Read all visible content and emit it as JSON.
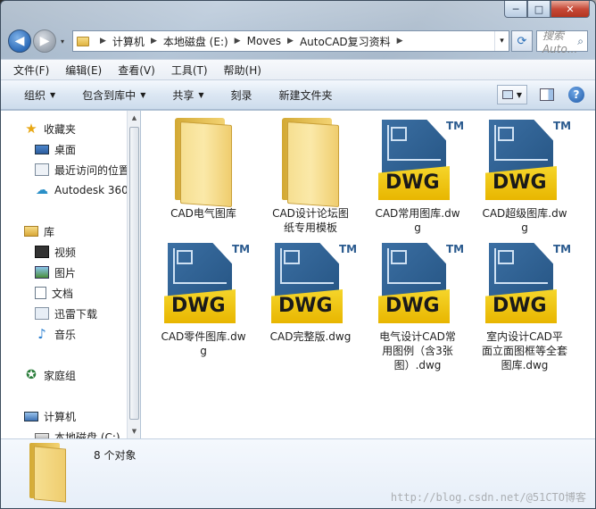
{
  "window": {
    "caption": {
      "minimize": "─",
      "maximize": "□",
      "close": "✕"
    }
  },
  "nav": {
    "back_icon": "◀",
    "forward_icon": "▶",
    "history_icon": "▾",
    "breadcrumb": [
      "计算机",
      "本地磁盘 (E:)",
      "Moves",
      "AutoCAD复习资料"
    ],
    "address_dropdown_icon": "▾",
    "refresh_icon": "⟳",
    "search_placeholder": "搜索 Auto...",
    "search_icon": "⌕"
  },
  "menu": [
    "文件(F)",
    "编辑(E)",
    "查看(V)",
    "工具(T)",
    "帮助(H)"
  ],
  "toolbar": {
    "organize": "组织",
    "include_library": "包含到库中",
    "share": "共享",
    "burn": "刻录",
    "new_folder": "新建文件夹",
    "help": "?"
  },
  "sidebar": {
    "favorites": "收藏夹",
    "items": [
      "桌面",
      "最近访问的位置",
      "Autodesk 360"
    ],
    "libraries": "库",
    "library_items": [
      "视频",
      "图片",
      "文档",
      "迅雷下载",
      "音乐"
    ],
    "homegroup": "家庭组",
    "computer": "计算机",
    "drive": "本地磁盘 (C:)"
  },
  "files": [
    {
      "name": "CAD电气图库",
      "type": "folder"
    },
    {
      "name": "CAD设计论坛图纸专用模板",
      "type": "folder"
    },
    {
      "name": "CAD常用图库.dwg",
      "type": "dwg"
    },
    {
      "name": "CAD超级图库.dwg",
      "type": "dwg"
    },
    {
      "name": "CAD零件图库.dwg",
      "type": "dwg"
    },
    {
      "name": "CAD完整版.dwg",
      "type": "dwg"
    },
    {
      "name": "电气设计CAD常用图例（含3张图）.dwg",
      "type": "dwg"
    },
    {
      "name": "室内设计CAD平面立面图框等全套图库.dwg",
      "type": "dwg"
    }
  ],
  "dwg_icon": {
    "word": "DWG",
    "tm": "TM"
  },
  "status": {
    "count": "8 个对象"
  },
  "watermark": "http://blog.csdn.net/@51CTO博客"
}
